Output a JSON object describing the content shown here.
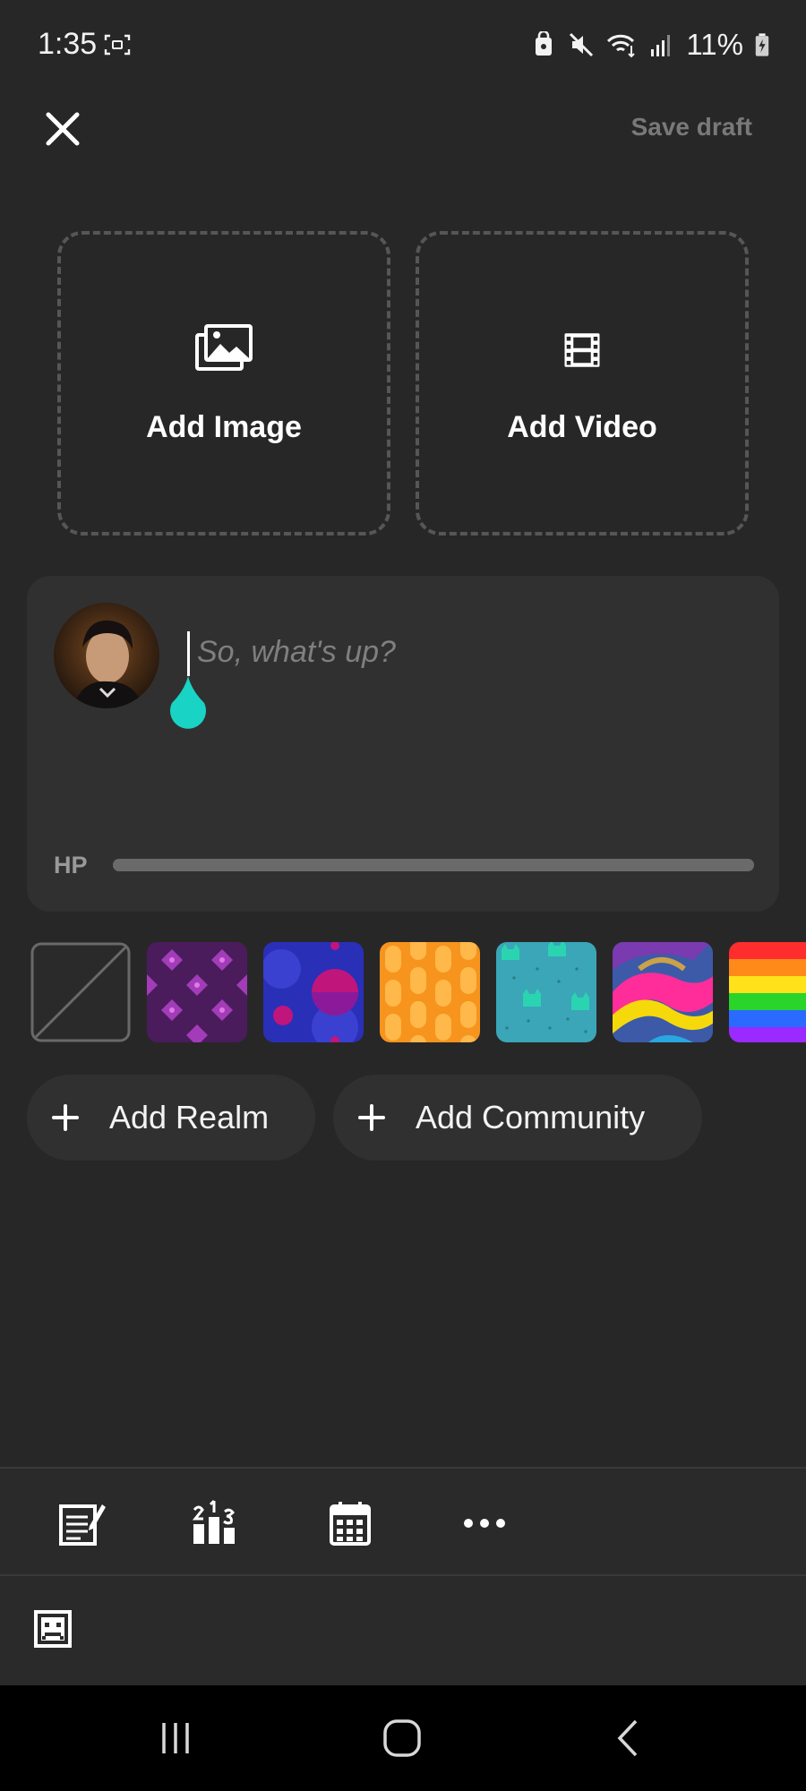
{
  "status_bar": {
    "time": "1:35",
    "battery_text": "11%",
    "icons": [
      "screen-record-icon",
      "lock-icon",
      "mute-icon",
      "wifi-icon",
      "signal-icon",
      "battery-charging-icon"
    ]
  },
  "header": {
    "close_icon": "close-icon",
    "save_draft_label": "Save draft"
  },
  "media": {
    "add_image_label": "Add Image",
    "add_video_label": "Add Video"
  },
  "composer": {
    "placeholder": "So, what's up?",
    "value": "",
    "hp_label": "HP",
    "hp_level": 1.0,
    "handle_color": "#19d3c5"
  },
  "backgrounds": [
    {
      "name": "none",
      "colors": [
        "#2b2a2b",
        "#6a696a"
      ]
    },
    {
      "name": "purple-diamonds",
      "colors": [
        "#4a1c5c",
        "#b04ac0"
      ]
    },
    {
      "name": "blue-bubbles",
      "colors": [
        "#2a2fb8",
        "#c0157a"
      ]
    },
    {
      "name": "orange-pills",
      "colors": [
        "#f7941d",
        "#ffc06a"
      ]
    },
    {
      "name": "teal-cats",
      "colors": [
        "#3aa6b8",
        "#2bd4b0"
      ]
    },
    {
      "name": "colorful-waves",
      "colors": [
        "#ff2d9a",
        "#f5d90a"
      ]
    },
    {
      "name": "rainbow",
      "colors": [
        "#ff2d2d",
        "#7a2dff"
      ]
    }
  ],
  "tags": {
    "add_realm_label": "Add Realm",
    "add_community_label": "Add Community"
  },
  "toolbar": {
    "items": [
      "text-post-icon",
      "poll-icon",
      "calendar-icon",
      "more-icon"
    ]
  },
  "secondary": {
    "emoji_icon": "pixel-face-icon"
  },
  "nav": {
    "items": [
      "recent-apps-icon",
      "home-icon",
      "back-icon"
    ]
  },
  "colors": {
    "background": "#282728",
    "card": "#313031",
    "accent": "#19d3c5",
    "muted_text": "#7a797a"
  }
}
